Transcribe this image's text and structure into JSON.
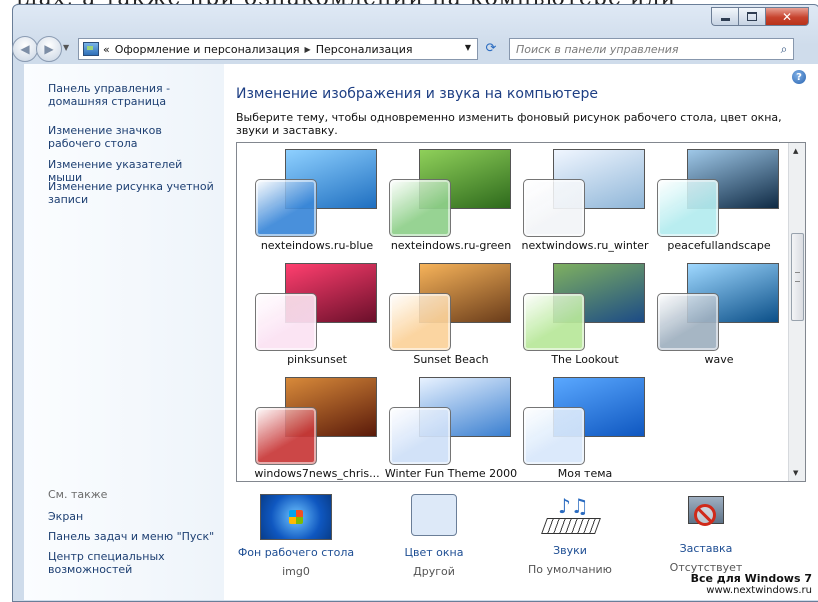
{
  "top_fragment": "ідах, а также при ознакомлении на компьютере или",
  "window": {
    "caption": [
      "minimize-icon",
      "maximize-icon",
      "close-icon"
    ]
  },
  "navbar": {
    "breadcrumbs": [
      "«",
      "Оформление и персонализация",
      "Персонализация"
    ],
    "search_placeholder": "Поиск в панели управления"
  },
  "left": {
    "links": [
      "Панель управления - домашняя страница",
      "Изменение значков рабочего стола",
      "Изменение указателей мыши",
      "Изменение рисунка учетной записи"
    ],
    "see_also": "См. также",
    "see_links": [
      "Экран",
      "Панель задач и меню \"Пуск\"",
      "Центр специальных возможностей"
    ]
  },
  "main": {
    "title": "Изменение изображения и звука на компьютере",
    "description": "Выберите тему, чтобы одновременно изменить фоновый рисунок рабочего стола, цвет окна, звуки и заставку.",
    "themes": [
      {
        "name": "nexteindows.ru-blue",
        "bg": "#1f6fc0",
        "bg2": "#8ed0ff",
        "glass": "#3a87d8"
      },
      {
        "name": "nexteindows.ru-green",
        "bg": "#2e6a1c",
        "bg2": "#8fd05a",
        "glass": "#8fd08a"
      },
      {
        "name": "nextwindows.ru_winter",
        "bg": "#8fb6d8",
        "bg2": "#f0f6ff",
        "glass": "#f3f5f8"
      },
      {
        "name": "peacefullandscape",
        "bg": "#0f2a44",
        "bg2": "#9fc8e8",
        "glass": "#b4ecef"
      },
      {
        "name": "pinksunset",
        "bg": "#6a0f2a",
        "bg2": "#ff3f6f",
        "glass": "#fbe2f3"
      },
      {
        "name": "Sunset Beach",
        "bg": "#6a3c1a",
        "bg2": "#f6b35a",
        "glass": "#fbd29a"
      },
      {
        "name": "The Lookout",
        "bg": "#1c4b86",
        "bg2": "#7fb060",
        "glass": "#b8e89a"
      },
      {
        "name": "wave",
        "bg": "#0b4f88",
        "bg2": "#9fd8ff",
        "glass": "#9fb0c0"
      },
      {
        "name": "windows7news_chris...",
        "bg": "#5a1a0a",
        "bg2": "#d88a3a",
        "glass": "#c83838"
      },
      {
        "name": "Winter Fun Theme 2000",
        "bg": "#3a7fd0",
        "bg2": "#e8f2ff",
        "glass": "#cfe0f8"
      },
      {
        "name": "Моя тема",
        "bg": "#0f57c0",
        "bg2": "#5aa8ff",
        "glass": "#d8e8fb"
      }
    ]
  },
  "bottom": {
    "items": [
      {
        "title": "Фон рабочего стола",
        "sub": "img0"
      },
      {
        "title": "Цвет окна",
        "sub": "Другой"
      },
      {
        "title": "Звуки",
        "sub": "По умолчанию"
      },
      {
        "title": "Заставка",
        "sub": "Отсутствует"
      }
    ],
    "watermark_1": "Все для Windows 7",
    "watermark_2": "www.nextwindows.ru"
  }
}
